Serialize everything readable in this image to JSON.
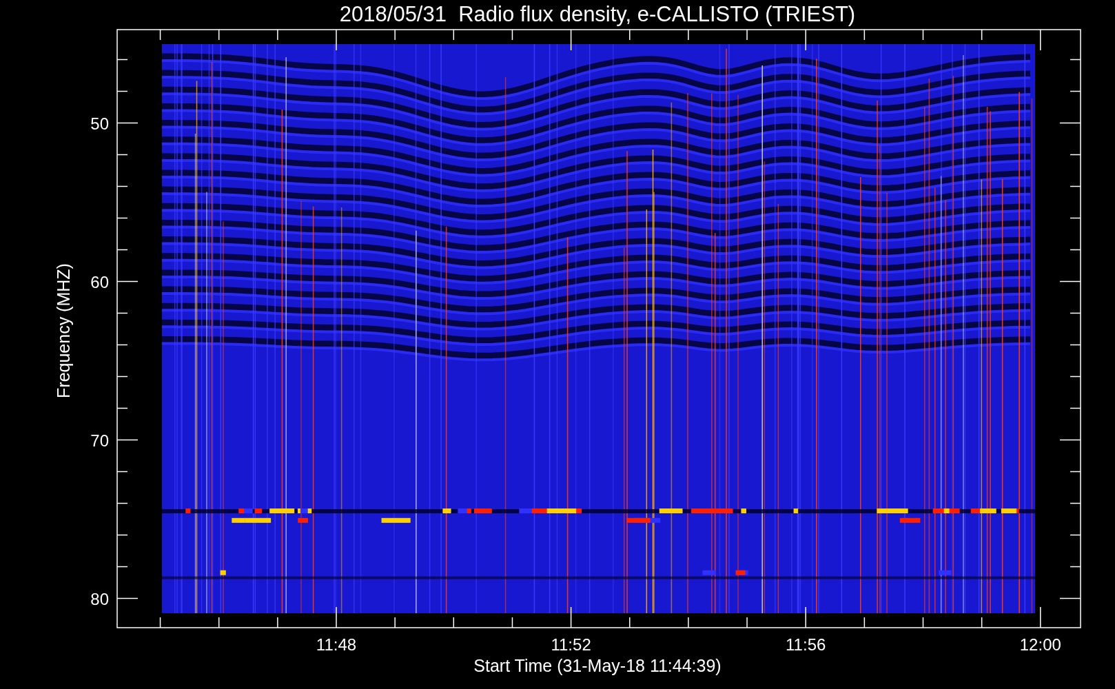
{
  "title": "2018/05/31  Radio flux density, e-CALLISTO (TRIEST)",
  "y_axis": {
    "label": "Frequency (MHZ)",
    "ticks": [
      "50",
      "60",
      "70",
      "80"
    ]
  },
  "x_axis": {
    "label": "Start Time (31-May-18 11:44:39)",
    "ticks": [
      "11:48",
      "11:52",
      "11:56",
      "12:00"
    ]
  }
}
